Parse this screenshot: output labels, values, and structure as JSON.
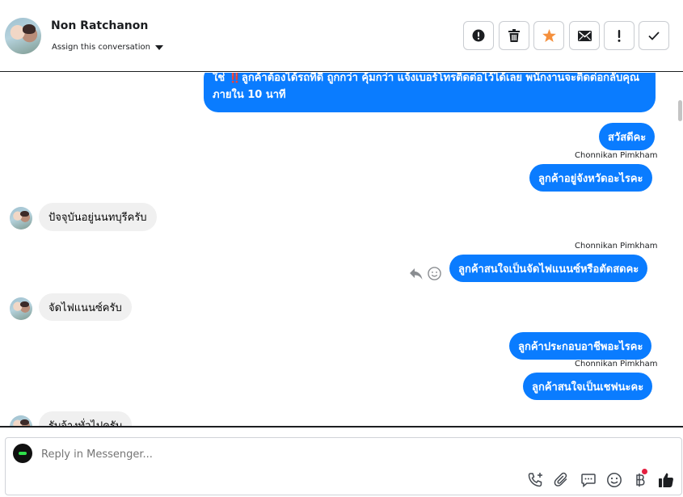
{
  "header": {
    "contact_name": "Non Ratchanon",
    "assign_label": "Assign this conversation",
    "actions": [
      {
        "name": "report-button",
        "icon": "alert-circle-icon"
      },
      {
        "name": "delete-button",
        "icon": "trash-icon"
      },
      {
        "name": "star-button",
        "icon": "star-icon"
      },
      {
        "name": "mark-unread-button",
        "icon": "envelope-icon"
      },
      {
        "name": "priority-button",
        "icon": "exclamation-icon"
      },
      {
        "name": "done-button",
        "icon": "check-icon"
      }
    ]
  },
  "messages": {
    "m1_text": "ใช่ ‼️ลูกค้าต้องได้รถที่ดี ถูกกว่า คุ้มกว่า แจ้งเบอร์โทรติดต่อไว้ได้เลย พนักงานจะติดต่อกลับคุณภายใน 10 นาที",
    "m2_text": "สวัสดีคะ",
    "m3_sender": "Chonnikan Pimkham",
    "m3_text": "ลูกค้าอยู่จังหวัดอะไรคะ",
    "m4_text": "ปัจจุบันอยู่นนทบุรีครับ",
    "m5_sender": "Chonnikan Pimkham",
    "m5_text": "ลูกค้าสนใจเป็นจัดไฟแนนซ์หรือตัดสดคะ",
    "m6_text": "จัดไฟแนนซ์ครับ",
    "m7_text": "ลูกค้าประกอบอาชีพอะไรคะ",
    "m8_sender": "Chonnikan Pimkham",
    "m8_text": "ลูกค้าสนใจเป็นเชฟนะคะ",
    "m9_text": "รับจ้างทั่วไปครับ"
  },
  "composer": {
    "placeholder": "Reply in Messenger...",
    "icons": [
      "call-add-icon",
      "attachment-icon",
      "saved-reply-icon",
      "emoji-icon",
      "baht-payment-icon",
      "like-icon"
    ]
  },
  "colors": {
    "outgoing_bubble": "#0a7cff",
    "incoming_bubble": "#f0f0f0",
    "star_accent": "#f5903d",
    "notification_dot": "#e41e3f"
  }
}
